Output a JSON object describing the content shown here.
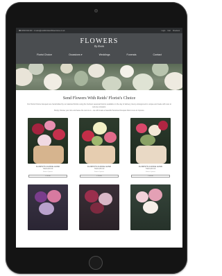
{
  "topbar": {
    "phone": "☎ 01506 834 000",
    "email": "✉ sales@reidsfloristandflowerstores.co.uk",
    "links": [
      "Login",
      "Cart",
      "Checkout"
    ]
  },
  "header": {
    "logo_main": "FLOWERS",
    "logo_sub": "By Reids"
  },
  "nav": {
    "items": [
      "Florist Choice",
      "Occasions ▾",
      "Weddings",
      "Funerals",
      "Contact"
    ]
  },
  "main": {
    "title": "Send Flowers With Reids' Florist's Choice",
    "intro_1": "Our Florist Choice bouquets are handcrafted by our talented florists using the freshest seasonal blooms available on the day of delivery. Every arrangement is unique and made with care to suit any occasion.",
    "intro_2": "Simply choose your size and leave the rest to us – we will create a beautiful hand-tied bouquet that is sure to impress."
  },
  "products": [
    {
      "title": "FLORISTS CHOICE HAND",
      "subtitle": "TIED £30.00",
      "link": "Select Options",
      "option": "£ 30.00"
    },
    {
      "title": "FLORISTS CHOICE HAND",
      "subtitle": "TIED £35.00",
      "link": "Select Options",
      "option": "£ 35.00"
    },
    {
      "title": "FLORISTS CHOICE HAND",
      "subtitle": "TIED £40.00",
      "link": "Select Options",
      "option": "£ 40.00"
    }
  ],
  "colors": {
    "bezel": "#141414",
    "topbar": "#2b2d2f",
    "header": "#4a4d50"
  }
}
